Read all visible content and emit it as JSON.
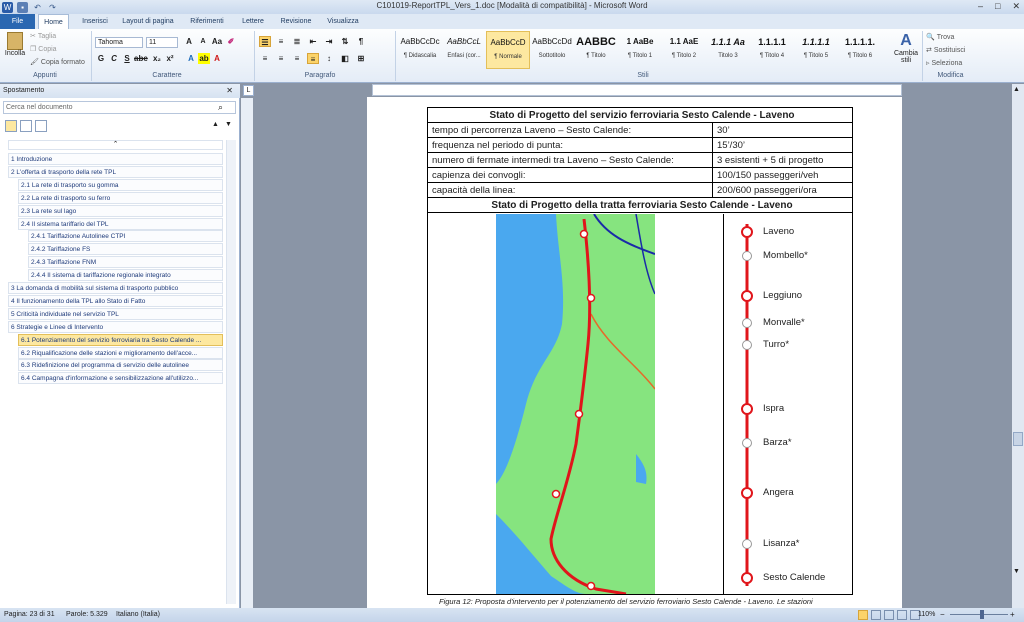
{
  "window": {
    "title": "C101019-ReportTPL_Vers_1.doc [Modalità di compatibilità] - Microsoft Word"
  },
  "tabs": [
    "File",
    "Home",
    "Inserisci",
    "Layout di pagina",
    "Riferimenti",
    "Lettere",
    "Revisione",
    "Visualizza"
  ],
  "ribbon": {
    "clipboard": {
      "paste": "Incolla",
      "cut": "Taglia",
      "copy": "Copia",
      "format_painter": "Copia formato",
      "label": "Appunti"
    },
    "font": {
      "name": "Tahoma",
      "size": "11",
      "label": "Carattere"
    },
    "paragraph": {
      "label": "Paragrafo"
    },
    "styles": {
      "label": "Stili",
      "items": [
        {
          "sample": "AaBbCcDc",
          "name": "¶ Didascalia"
        },
        {
          "sample": "AaBbCcL",
          "name": "Enfasi (cor..."
        },
        {
          "sample": "AaBbCcD",
          "name": "¶ Normale"
        },
        {
          "sample": "AaBbCcDd",
          "name": "Sottotitolo"
        },
        {
          "sample": "AABBC",
          "name": "¶ Titolo"
        },
        {
          "sample": "1 AaBe",
          "name": "¶ Titolo 1"
        },
        {
          "sample": "1.1 AaE",
          "name": "¶ Titolo 2"
        },
        {
          "sample": "1.1.1 Aa",
          "name": "Titolo 3"
        },
        {
          "sample": "1.1.1.1",
          "name": "¶ Titolo 4"
        },
        {
          "sample": "1.1.1.1",
          "name": "¶ Titolo 5"
        },
        {
          "sample": "1.1.1.1.",
          "name": "¶ Titolo 6"
        }
      ],
      "change": "Cambia stili"
    },
    "editing": {
      "find": "Trova",
      "replace": "Sostituisci",
      "select": "Seleziona",
      "label": "Modifica"
    }
  },
  "nav": {
    "title": "Spostamento",
    "search_placeholder": "Cerca nel documento",
    "items": [
      {
        "text": "1 Introduzione",
        "level": 1
      },
      {
        "text": "2 L'offerta di trasporto della rete TPL",
        "level": 1
      },
      {
        "text": "2.1 La rete di trasporto su gomma",
        "level": 2
      },
      {
        "text": "2.2 La rete di trasporto su ferro",
        "level": 2
      },
      {
        "text": "2.3 La rete sul lago",
        "level": 2
      },
      {
        "text": "2.4 Il sistema tariffario del TPL",
        "level": 2
      },
      {
        "text": "2.4.1 Tariffazione Autolinee CTPI",
        "level": 3
      },
      {
        "text": "2.4.2 Tariffazione FS",
        "level": 3
      },
      {
        "text": "2.4.3 Tariffazione FNM",
        "level": 3
      },
      {
        "text": "2.4.4 Il sistema di tariffazione regionale integrato",
        "level": 3
      },
      {
        "text": "3 La domanda di mobilità sul sistema di trasporto pubblico",
        "level": 1
      },
      {
        "text": "4 Il funzionamento della TPL allo Stato di Fatto",
        "level": 1
      },
      {
        "text": "5 Criticità individuate nel servizio TPL",
        "level": 1
      },
      {
        "text": "6 Strategie e Linee di Intervento",
        "level": 1
      },
      {
        "text": "6.1 Potenziamento del servizio ferroviaria tra Sesto Calende ...",
        "level": 2,
        "selected": true
      },
      {
        "text": "6.2 Riqualificazione delle stazioni e miglioramento dell'acce...",
        "level": 2
      },
      {
        "text": "6.3 Ridefinizione del programma di servizio delle autolinee",
        "level": 2
      },
      {
        "text": "6.4 Campagna d'informazione e sensibilizzazione all'utilizzo...",
        "level": 2
      }
    ]
  },
  "document": {
    "table_title": "Stato di Progetto del servizio ferroviaria Sesto Calende - Laveno",
    "rows": [
      {
        "label": "tempo di percorrenza Laveno – Sesto Calende:",
        "value": "30’"
      },
      {
        "label": "frequenza  nel periodo di punta:",
        "value": "15’/30’"
      },
      {
        "label": "numero di fermate intermedi tra Laveno – Sesto Calende:",
        "value": "3 esistenti + 5 di progetto"
      },
      {
        "label": "capienza dei convogli:",
        "value": "100/150 passeggeri/veh"
      },
      {
        "label": "capacità della linea:",
        "value": "200/600 passeggeri/ora"
      }
    ],
    "section_title": "Stato di Progetto della tratta ferroviaria Sesto Calende - Laveno",
    "stations": [
      {
        "name": "Laveno",
        "type": "existing"
      },
      {
        "name": "Mombello*",
        "type": "new"
      },
      {
        "name": "Leggiuno",
        "type": "existing"
      },
      {
        "name": "Monvalle*",
        "type": "new"
      },
      {
        "name": "Turro*",
        "type": "new"
      },
      {
        "name": "Ispra",
        "type": "existing"
      },
      {
        "name": "Barza*",
        "type": "new"
      },
      {
        "name": "Angera",
        "type": "existing"
      },
      {
        "name": "Lisanza*",
        "type": "new"
      },
      {
        "name": "Sesto Calende",
        "type": "existing"
      }
    ],
    "caption": "Figura 12: Proposta d'intervento per il potenziamento del servizio ferroviario Sesto Calende - Laveno. Le stazioni",
    "line_color": "#e0151b"
  },
  "status": {
    "page": "Pagina: 23 di 31",
    "words": "Parole: 5.329",
    "language": "Italiano (Italia)",
    "zoom": "110%"
  }
}
